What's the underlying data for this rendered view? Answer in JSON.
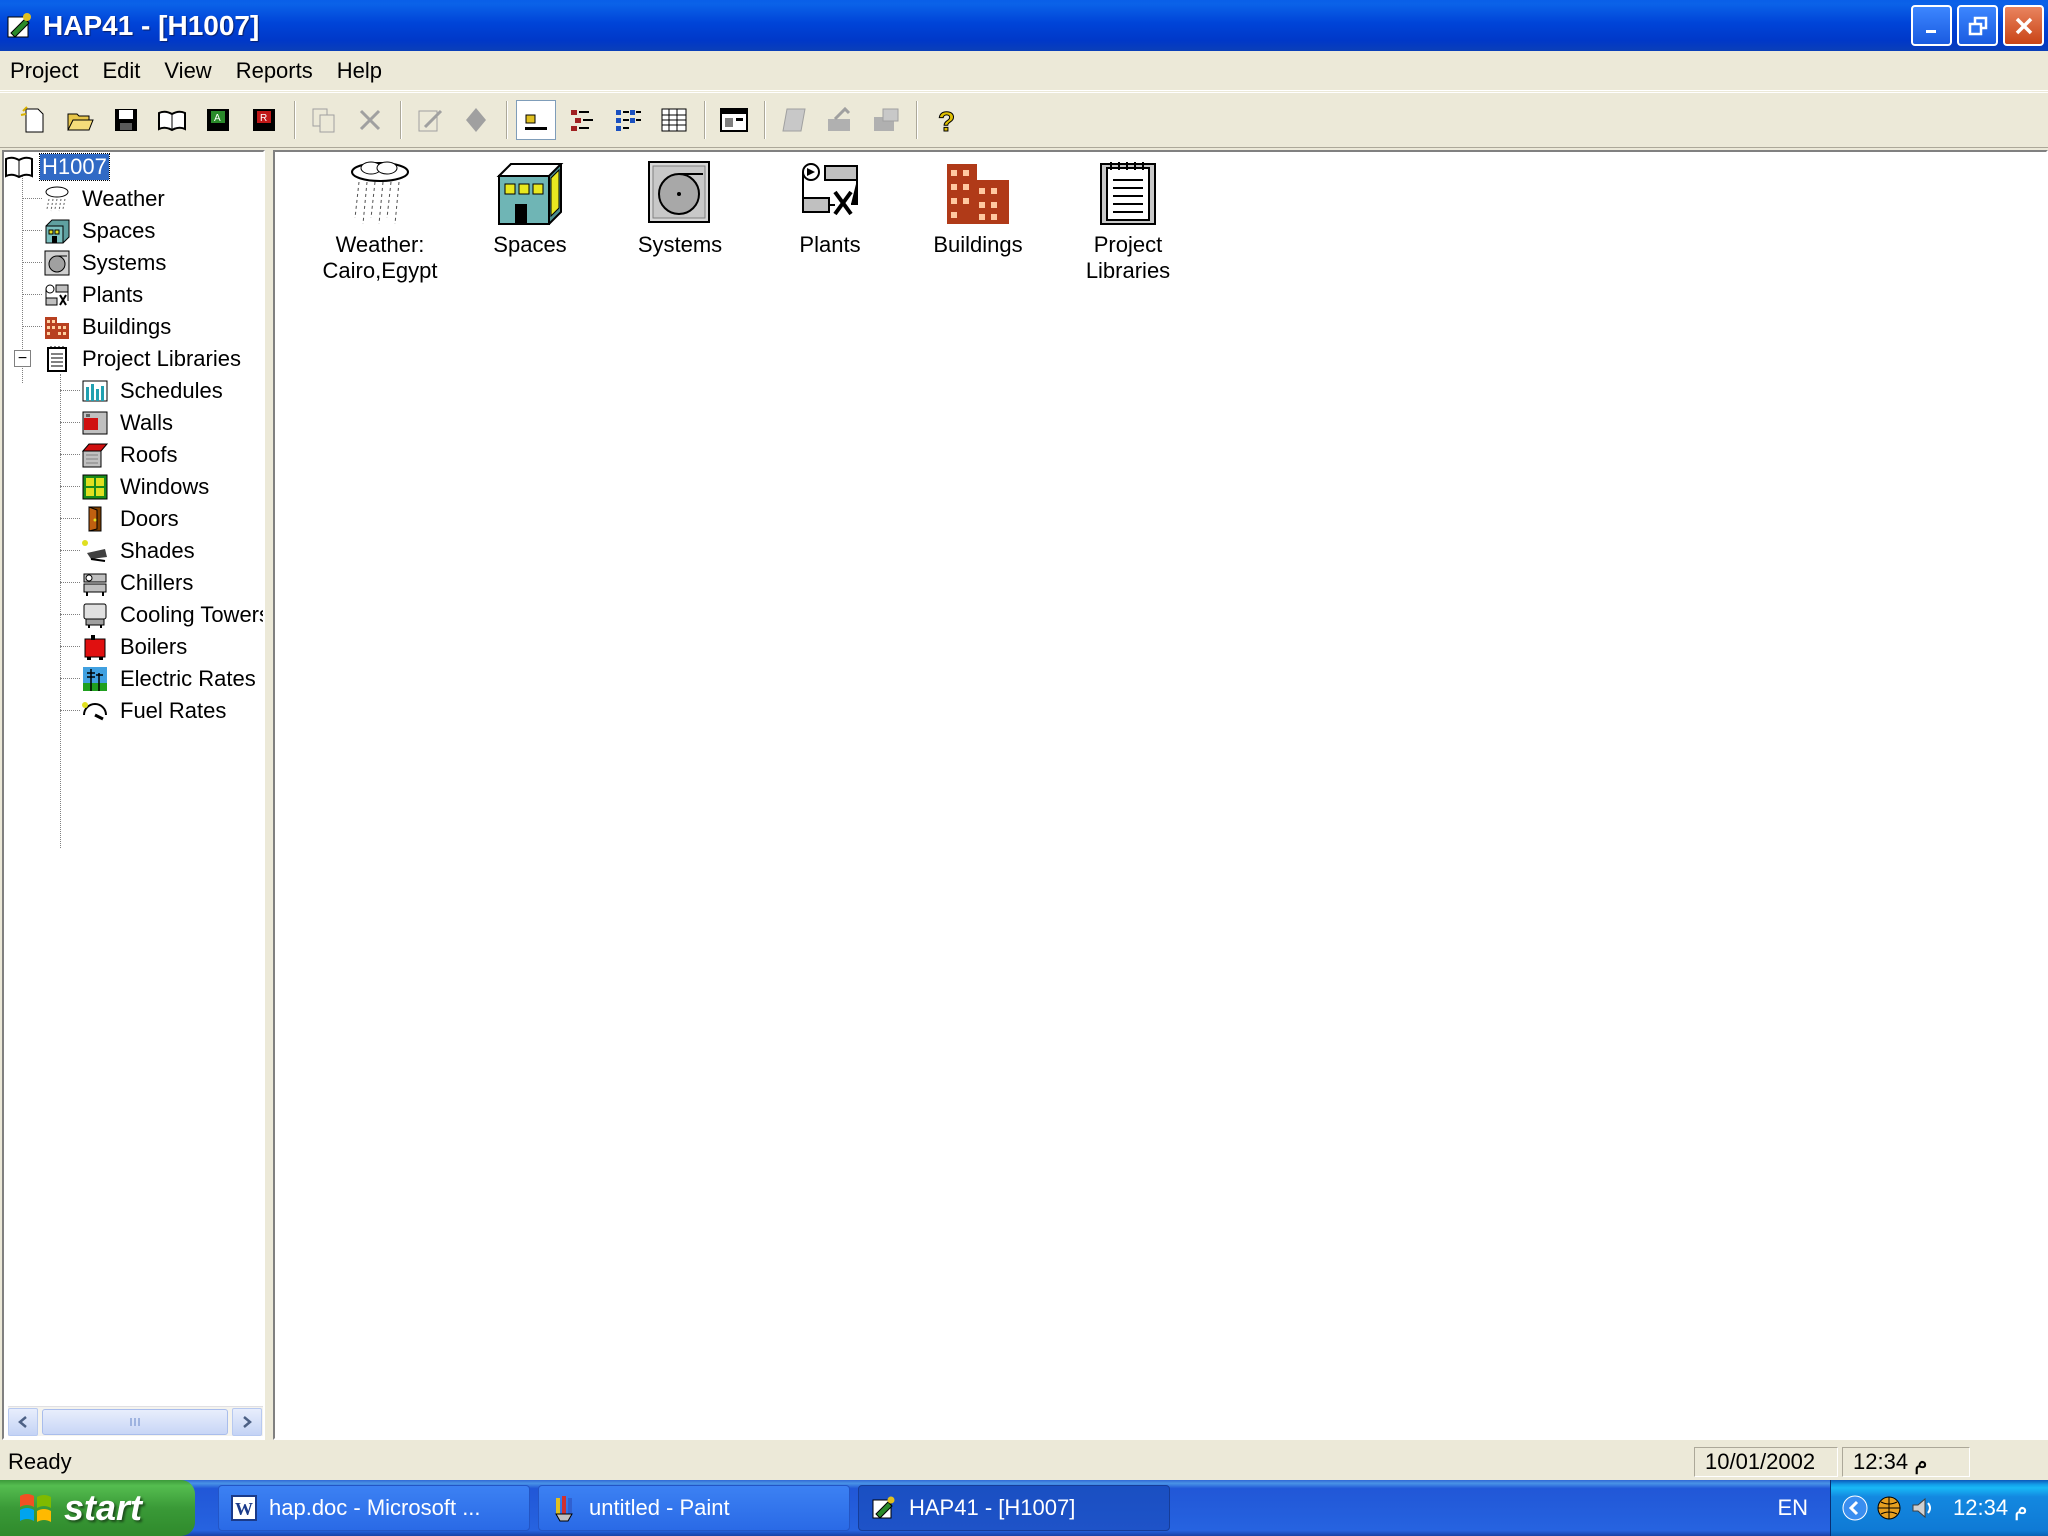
{
  "window": {
    "title": "HAP41 - [H1007]"
  },
  "menu": [
    "Project",
    "Edit",
    "View",
    "Reports",
    "Help"
  ],
  "toolbar": {
    "buttons": [
      "new-project-icon",
      "open-project-icon",
      "save-icon",
      "open-book-icon",
      "save-as-icon",
      "close-project-icon",
      "copy-icon",
      "delete-icon",
      "edit-icon",
      "properties-icon",
      "large-icons-icon",
      "small-icons-icon",
      "list-icon",
      "details-icon",
      "print-preview-icon",
      "report-icon",
      "calculate-icon",
      "print-icon",
      "help-icon"
    ]
  },
  "tree": {
    "root": "H1007",
    "items": [
      "Weather",
      "Spaces",
      "Systems",
      "Plants",
      "Buildings",
      "Project Libraries"
    ],
    "libraries": [
      "Schedules",
      "Walls",
      "Roofs",
      "Windows",
      "Doors",
      "Shades",
      "Chillers",
      "Cooling Towers",
      "Boilers",
      "Electric Rates",
      "Fuel Rates"
    ],
    "expander": "−"
  },
  "content": {
    "icons": [
      {
        "line1": "Weather:",
        "line2": "Cairo,Egypt"
      },
      {
        "line1": "Spaces",
        "line2": ""
      },
      {
        "line1": "Systems",
        "line2": ""
      },
      {
        "line1": "Plants",
        "line2": ""
      },
      {
        "line1": "Buildings",
        "line2": ""
      },
      {
        "line1": "Project",
        "line2": "Libraries"
      }
    ]
  },
  "status": {
    "text": "Ready",
    "date": "10/01/2002",
    "time": "12:34 م"
  },
  "taskbar": {
    "start": "start",
    "tasks": [
      "hap.doc - Microsoft ...",
      "untitled - Paint",
      "HAP41 - [H1007]"
    ],
    "language": "EN",
    "clock": "12:34 م"
  },
  "colors": {
    "selection": "#316ac5",
    "titlebar": "#0044d8",
    "taskbar": "#2663e0",
    "start": "#3a9a37"
  }
}
